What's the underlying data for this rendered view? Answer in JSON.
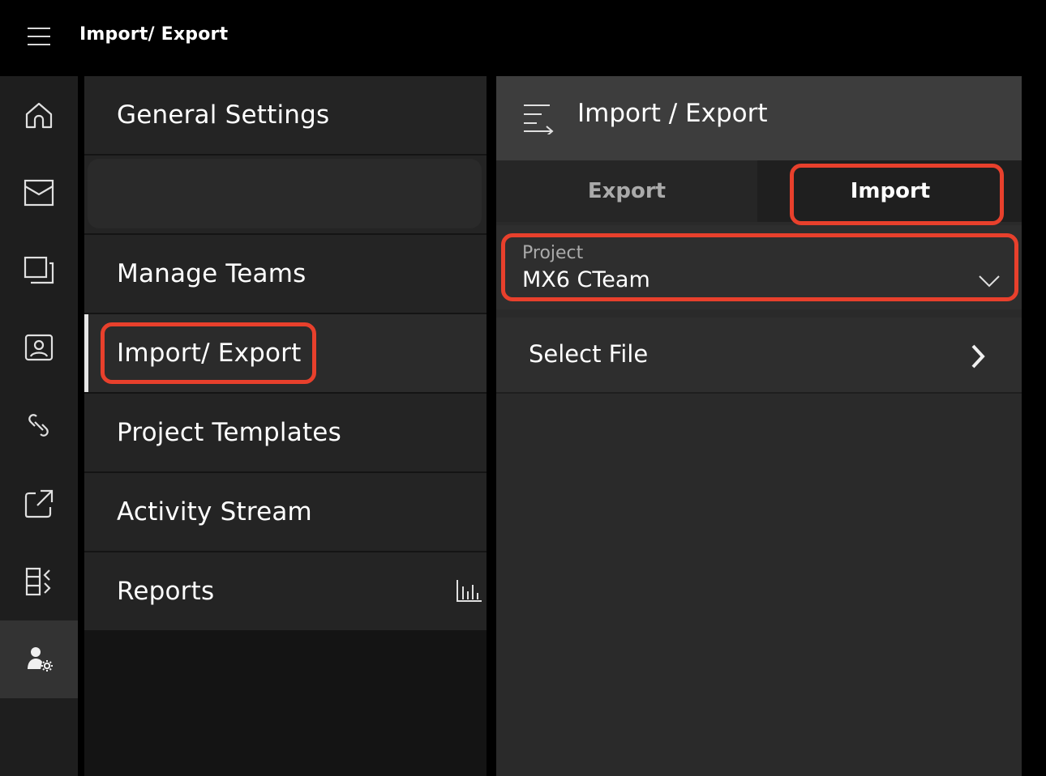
{
  "header": {
    "title": "Import/ Export"
  },
  "rail": {
    "items": [
      {
        "icon": "home-icon"
      },
      {
        "icon": "mail-icon"
      },
      {
        "icon": "windows-icon"
      },
      {
        "icon": "contact-card-icon"
      },
      {
        "icon": "link-icon"
      },
      {
        "icon": "share-out-icon"
      },
      {
        "icon": "transfer-icon"
      },
      {
        "icon": "admin-settings-icon",
        "active": true
      }
    ]
  },
  "settings": {
    "items": [
      {
        "label": "General Settings"
      },
      {
        "label": "Manage Teams"
      },
      {
        "label": "Import/ Export",
        "active": true
      },
      {
        "label": "Project Templates"
      },
      {
        "label": "Activity Stream"
      },
      {
        "label": "Reports",
        "icon": "bar-chart-icon"
      }
    ]
  },
  "detail": {
    "title": "Import / Export",
    "tabs": {
      "export": "Export",
      "import": "Import",
      "selected": "Import"
    },
    "project": {
      "label": "Project",
      "value": "MX6 CTeam"
    },
    "select_file": "Select File"
  },
  "colors": {
    "highlight": "#e8402c",
    "accent_text": "#ffffff"
  }
}
